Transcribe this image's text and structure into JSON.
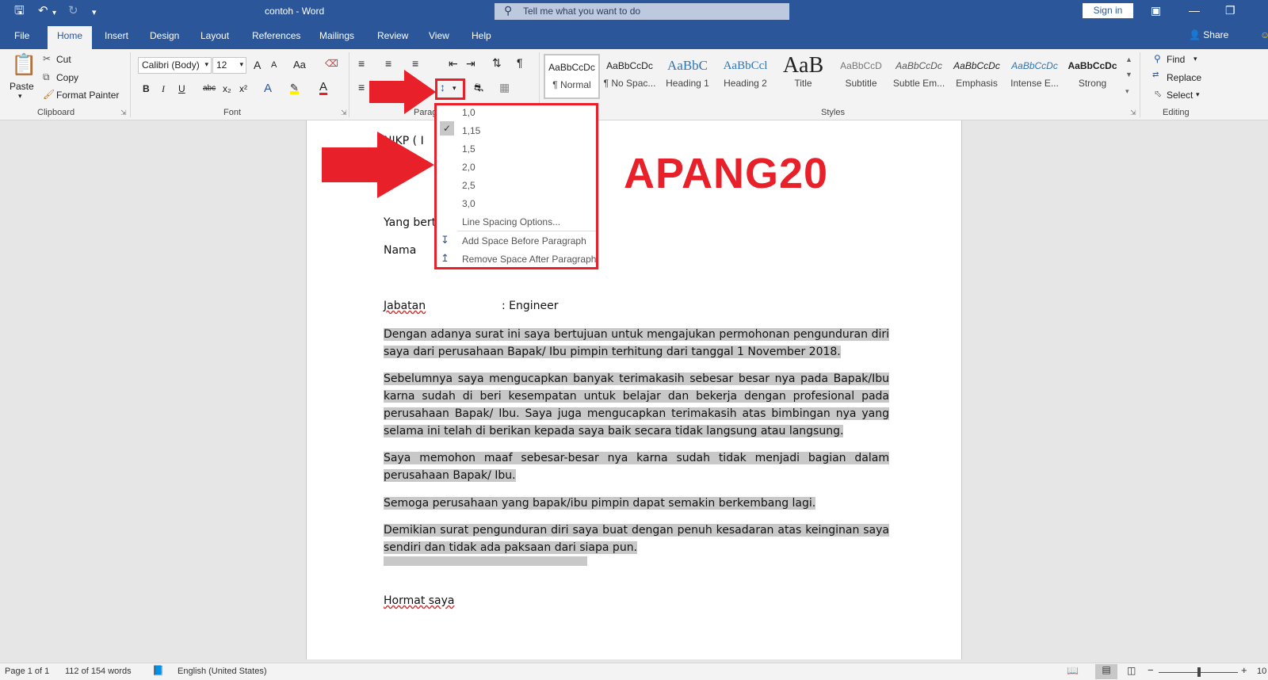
{
  "titlebar": {
    "doc_title": "contoh  -  Word",
    "tellme": "Tell me what you want to do",
    "signin": "Sign in",
    "save_icon": "save-icon",
    "undo_icon": "undo-icon",
    "redo_icon": "redo-icon"
  },
  "tabs": {
    "file": "File",
    "home": "Home",
    "insert": "Insert",
    "design": "Design",
    "layout": "Layout",
    "references": "References",
    "mailings": "Mailings",
    "review": "Review",
    "view": "View",
    "help": "Help",
    "share": "Share"
  },
  "clipboard": {
    "paste": "Paste",
    "cut": "Cut",
    "copy": "Copy",
    "format_painter": "Format Painter",
    "label": "Clipboard"
  },
  "font": {
    "name": "Calibri (Body)",
    "size": "12",
    "label": "Font",
    "grow": "A",
    "shrink": "A",
    "case": "Aa",
    "bold": "B",
    "italic": "I",
    "underline": "U",
    "strike": "abc",
    "sub": "x₂",
    "sup": "x²",
    "effects": "A",
    "font_color": "A"
  },
  "paragraph": {
    "label": "Parag"
  },
  "styles": {
    "label": "Styles",
    "items": [
      {
        "sample": "AaBbCcDc",
        "name": "¶ Normal"
      },
      {
        "sample": "AaBbCcDc",
        "name": "¶ No Spac..."
      },
      {
        "sample": "AaBbC",
        "name": "Heading 1"
      },
      {
        "sample": "AaBbCcl",
        "name": "Heading 2"
      },
      {
        "sample": "AaB",
        "name": "Title"
      },
      {
        "sample": "AaBbCcD",
        "name": "Subtitle"
      },
      {
        "sample": "AaBbCcDc",
        "name": "Subtle Em..."
      },
      {
        "sample": "AaBbCcDc",
        "name": "Emphasis"
      },
      {
        "sample": "AaBbCcDc",
        "name": "Intense E..."
      },
      {
        "sample": "AaBbCcDc",
        "name": "Strong"
      }
    ]
  },
  "editing": {
    "find": "Find",
    "replace": "Replace",
    "select": "Select",
    "label": "Editing"
  },
  "line_spacing_menu": {
    "options": [
      "1,0",
      "1,15",
      "1,5",
      "2,0",
      "2,5",
      "3,0"
    ],
    "selected": "1,15",
    "more": "Line Spacing Options...",
    "add_before": "Add Space Before Paragraph",
    "remove_after": "Remove Space After Paragraph"
  },
  "document": {
    "frag1": "NIKP ( I",
    "frag2": "ang",
    "frag3": "Yang bert",
    "nama": "Nama",
    "jabatan_label": "Jabatan",
    "jabatan_value": ": Engineer",
    "p1": "Dengan adanya surat ini saya bertujuan untuk mengajukan permohonan pengunduran diri saya dari perusahaan Bapak/ Ibu pimpin terhitung dari tanggal 1 November 2018.",
    "p2": "Sebelumnya saya mengucapkan banyak terimakasih sebesar besar nya pada Bapak/Ibu karna sudah di beri kesempatan untuk belajar dan bekerja dengan profesional pada perusahaan Bapak/ Ibu. Saya juga mengucapkan terimakasih atas bimbingan nya yang selama ini telah di berikan kepada saya baik secara tidak langsung atau langsung.",
    "p3": "Saya memohon maaf sebesar-besar nya karna sudah tidak menjadi bagian dalam perusahaan Bapak/ Ibu.",
    "p4": "Semoga perusahaan yang bapak/ibu pimpin dapat semakin berkembang lagi.",
    "p5": "Demikian surat pengunduran diri saya buat dengan penuh kesadaran atas keinginan saya sendiri dan tidak ada paksaan dari siapa pun.",
    "closing": "Hormat saya"
  },
  "watermark": "APANG20",
  "status": {
    "page": "Page 1 of 1",
    "words": "112 of 154 words",
    "language": "English (United States)",
    "zoom": "10"
  }
}
